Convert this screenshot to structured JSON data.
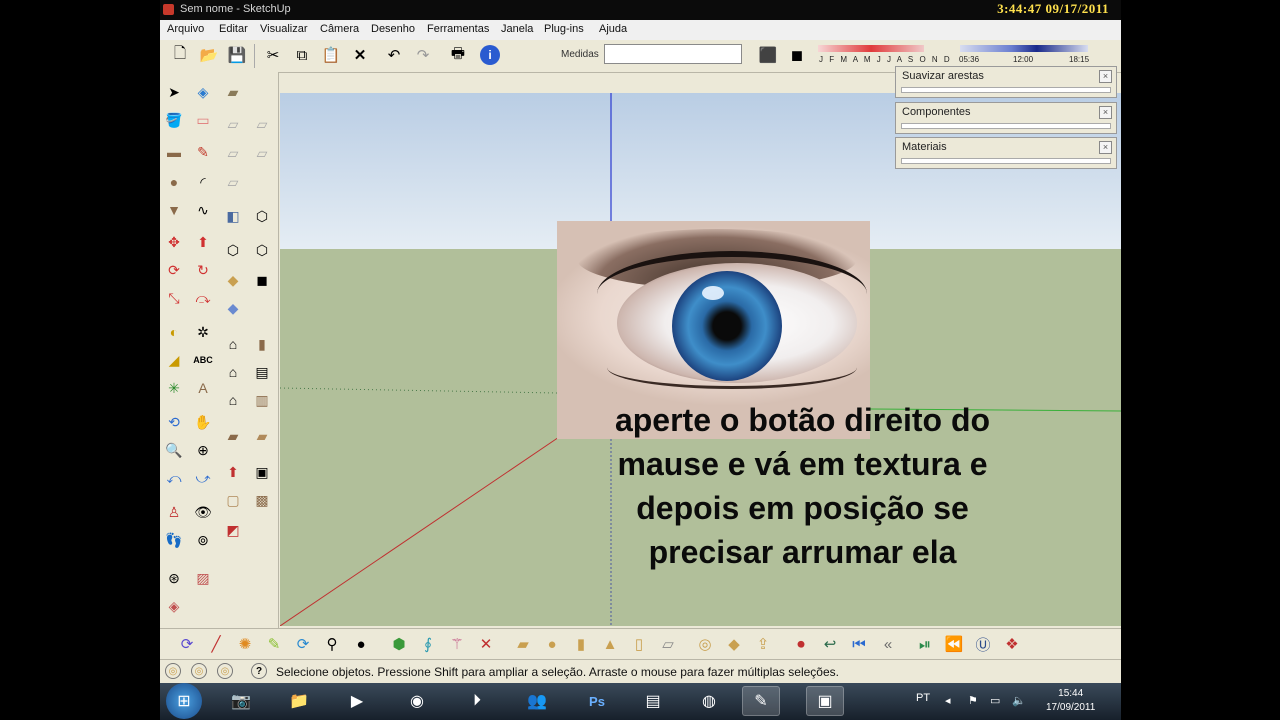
{
  "window": {
    "title": "Sem nome - SketchUp",
    "clock": "3:44:47  09/17/2011"
  },
  "menu": [
    "Arquivo",
    "Editar",
    "Visualizar",
    "Câmera",
    "Desenho",
    "Ferramentas",
    "Janela",
    "Plug-ins",
    "Ajuda"
  ],
  "toolbar": {
    "medidas_label": "Medidas",
    "medidas_value": ""
  },
  "shadow_settings": {
    "months": "J F M A M J J A S O N D",
    "times": [
      "05:36",
      "12:00",
      "18:15"
    ]
  },
  "panels": [
    {
      "title": "Suavizar arestas"
    },
    {
      "title": "Componentes"
    },
    {
      "title": "Materiais"
    }
  ],
  "viewport": {
    "instruction": "aperte o botão direito do mause e vá em textura e depois em posição se precisar arrumar ela",
    "sky_color": "#c9d8ea",
    "ground_color": "#b1bf9a"
  },
  "statusbar": {
    "hint": "Selecione objetos. Pressione Shift para ampliar a seleção. Arraste o mouse para fazer múltiplas seleções."
  },
  "taskbar": {
    "language": "PT",
    "time": "15:44",
    "date": "17/09/2011"
  }
}
